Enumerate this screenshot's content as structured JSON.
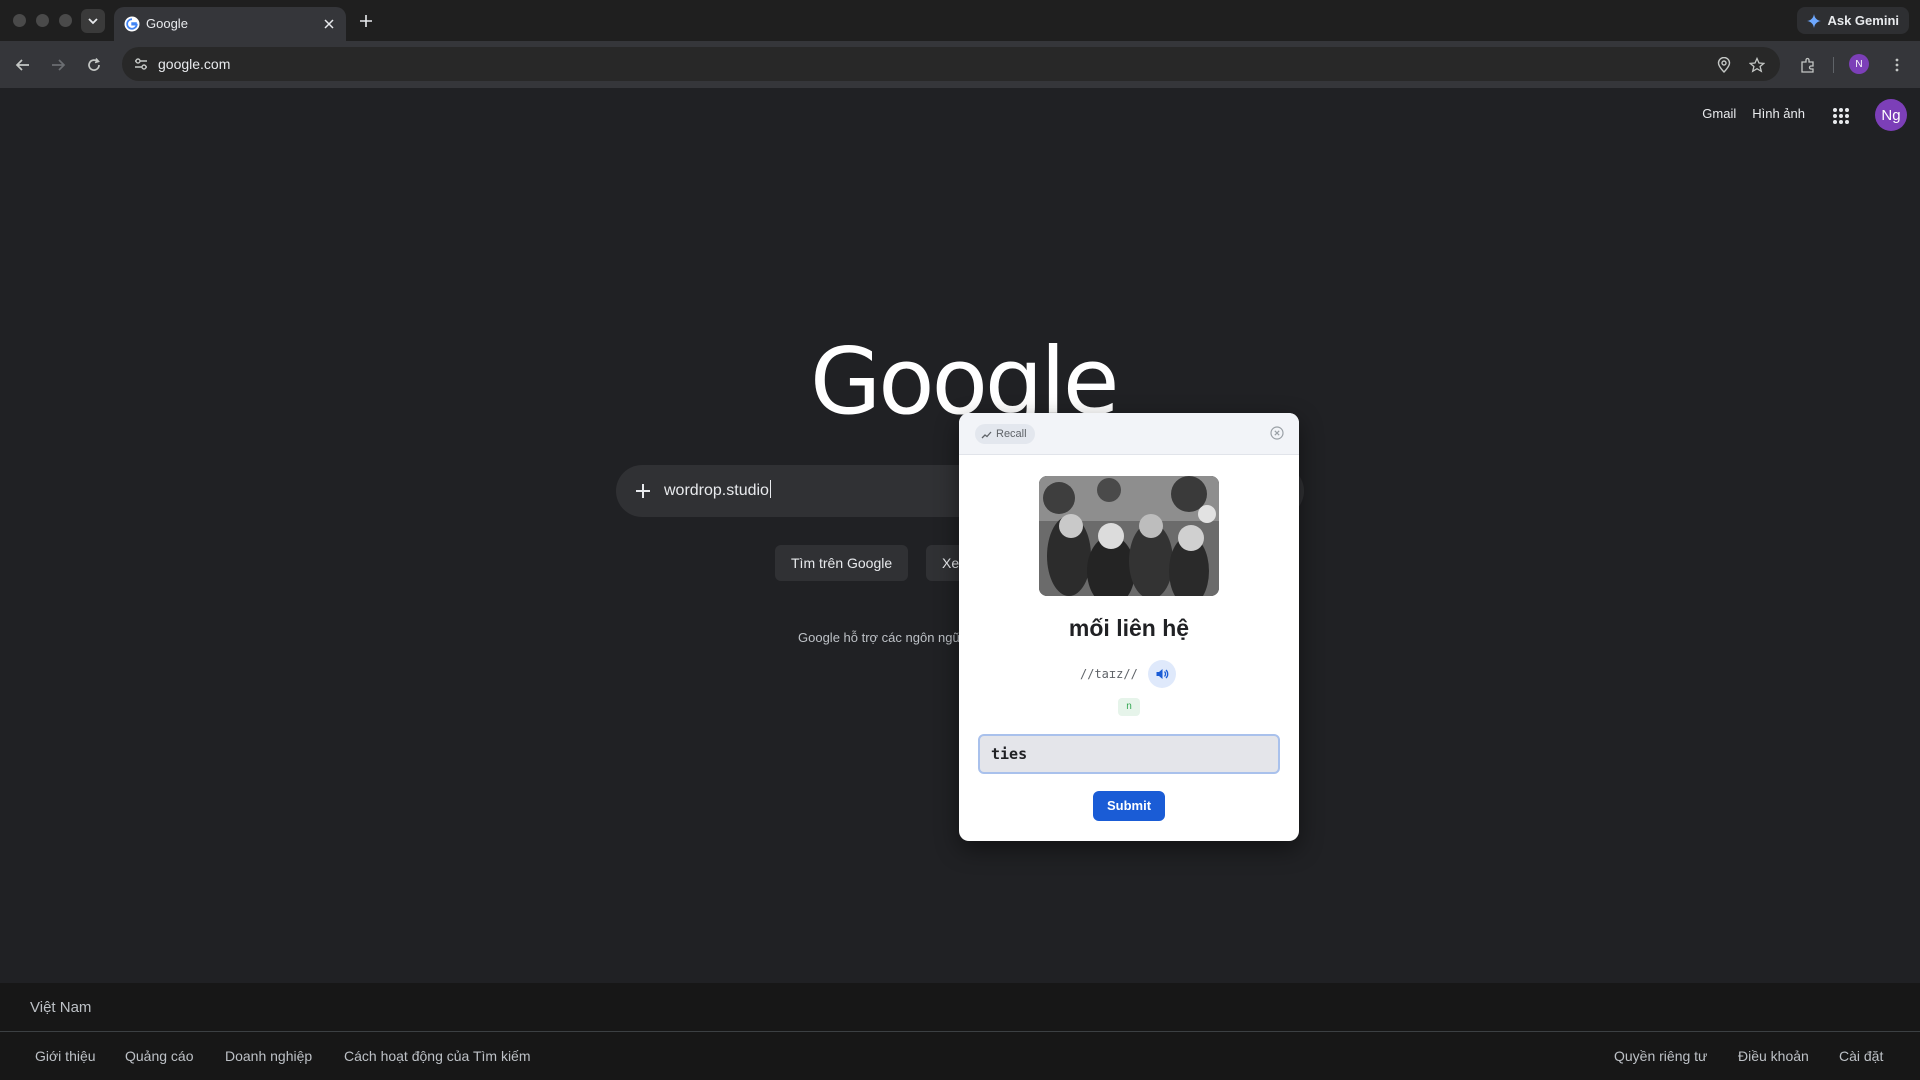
{
  "browser": {
    "tab_title": "Google",
    "url": "google.com",
    "ask_gemini_label": "Ask Gemini",
    "profile_initial": "N"
  },
  "header": {
    "gmail_label": "Gmail",
    "images_label": "Hình ảnh",
    "avatar_initials": "Ng"
  },
  "main": {
    "logo_text": "Google",
    "search_value": "wordrop.studio",
    "search_button_label": "Tìm trên Google",
    "lucky_button_label": "Xe",
    "language_text": "Google hỗ trợ các ngôn ngữ"
  },
  "footer": {
    "country": "Việt Nam",
    "left_links": [
      "Giới thiệu",
      "Quảng cáo",
      "Doanh nghiệp",
      "Cách hoạt động của Tìm kiếm"
    ],
    "right_links": [
      "Quyền riêng tư",
      "Điều khoản",
      "Cài đặt"
    ]
  },
  "popup": {
    "badge_label": "Recall",
    "word": "mối liên hệ",
    "phonetic": "//taɪz//",
    "part_of_speech": "n",
    "answer_value": "ties",
    "submit_label": "Submit"
  },
  "colors": {
    "page_bg": "#202124",
    "accent_blue": "#1a5cd6",
    "avatar_purple": "#7c3fb8"
  }
}
